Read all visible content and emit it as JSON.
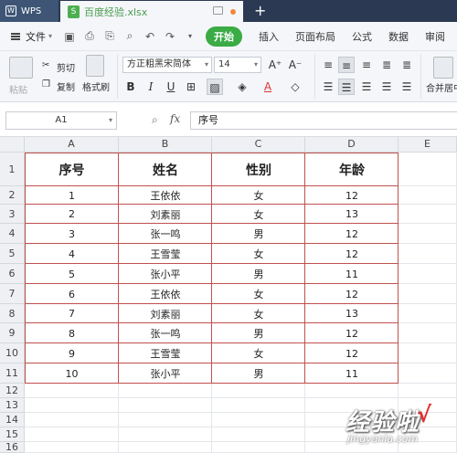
{
  "titlebar": {
    "app_tab": "WPS",
    "file_tab": "百度经验.xlsx",
    "new_tab": "+"
  },
  "menubar": {
    "file_label": "文件",
    "start_label": "开始",
    "items": [
      "插入",
      "页面布局",
      "公式",
      "数据",
      "审阅"
    ]
  },
  "ribbon": {
    "cut": "剪切",
    "paste": "粘贴",
    "copy": "复制",
    "format_painter": "格式刷",
    "font_name": "方正粗黑宋简体",
    "font_size": "14",
    "merge_center": "合并居中"
  },
  "formula_bar": {
    "cell_ref": "A1",
    "fx": "fx",
    "content": "序号"
  },
  "columns": [
    "A",
    "B",
    "C",
    "D",
    "E"
  ],
  "rows": [
    "1",
    "2",
    "3",
    "4",
    "5",
    "6",
    "7",
    "8",
    "9",
    "10",
    "11",
    "12",
    "13",
    "14",
    "15",
    "16"
  ],
  "table": {
    "headers": [
      "序号",
      "姓名",
      "性别",
      "年龄"
    ],
    "rows": [
      [
        "1",
        "王依依",
        "女",
        "12"
      ],
      [
        "2",
        "刘素丽",
        "女",
        "13"
      ],
      [
        "3",
        "张一鸣",
        "男",
        "12"
      ],
      [
        "4",
        "王雪莹",
        "女",
        "12"
      ],
      [
        "5",
        "张小平",
        "男",
        "11"
      ],
      [
        "6",
        "王依依",
        "女",
        "12"
      ],
      [
        "7",
        "刘素丽",
        "女",
        "13"
      ],
      [
        "8",
        "张一鸣",
        "男",
        "12"
      ],
      [
        "9",
        "王雪莹",
        "女",
        "12"
      ],
      [
        "10",
        "张小平",
        "男",
        "11"
      ]
    ]
  },
  "watermark": {
    "text": "经验啦",
    "url": "jingyanla.com"
  },
  "colors": {
    "accent_green": "#3aab45",
    "table_border": "#c0504d",
    "titlebar": "#2b3a52"
  }
}
